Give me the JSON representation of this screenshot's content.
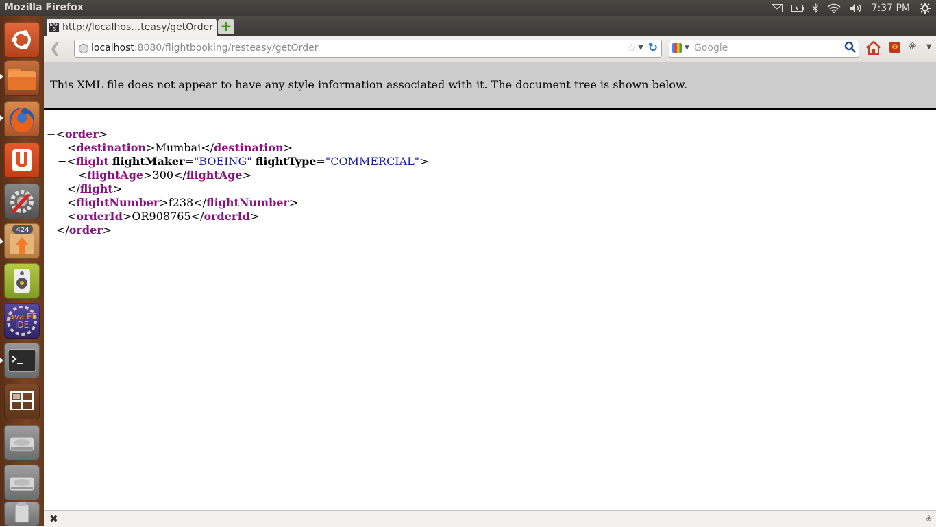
{
  "panel": {
    "app_title": "Mozilla Firefox",
    "clock": "7:37 PM",
    "icons": [
      "mail-icon",
      "battery-icon",
      "bluetooth-icon",
      "wifi-icon",
      "volume-icon",
      "settings-gear-icon"
    ]
  },
  "launcher": {
    "items": [
      {
        "name": "ubuntu-home-icon"
      },
      {
        "name": "files-icon"
      },
      {
        "name": "firefox-icon"
      },
      {
        "name": "ubuntu-one-icon"
      },
      {
        "name": "system-settings-icon"
      },
      {
        "name": "update-manager-icon",
        "badge": "424"
      },
      {
        "name": "audio-player-icon"
      },
      {
        "name": "java-ee-ide-icon",
        "label": "Java EE IDE"
      },
      {
        "name": "terminal-icon"
      },
      {
        "name": "workspace-switcher-icon"
      },
      {
        "name": "drive-icon"
      },
      {
        "name": "drive-icon"
      },
      {
        "name": "usb-drive-icon"
      }
    ]
  },
  "browser": {
    "tab_label": "http://localhos…teasy/getOrder",
    "tab_favicon_text": "EAP 6",
    "new_tab_label": "+",
    "url_host": "localhost",
    "url_rest": ":8080/flightbooking/resteasy/getOrder",
    "search_placeholder": "Google"
  },
  "xml_page": {
    "banner": "This XML file does not appear to have any style information associated with it. The document tree is shown below.",
    "root_tag": "order",
    "destination_tag": "destination",
    "destination_value": "Mumbai",
    "flight_tag": "flight",
    "flight_attr1_name": "flightMaker",
    "flight_attr1_value": "\"BOEING\"",
    "flight_attr2_name": "flightType",
    "flight_attr2_value": "\"COMMERCIAL\"",
    "flightage_tag": "flightAge",
    "flightage_value": "300",
    "flightnumber_tag": "flightNumber",
    "flightnumber_value": "f238",
    "orderid_tag": "orderId",
    "orderid_value": "OR908765"
  }
}
